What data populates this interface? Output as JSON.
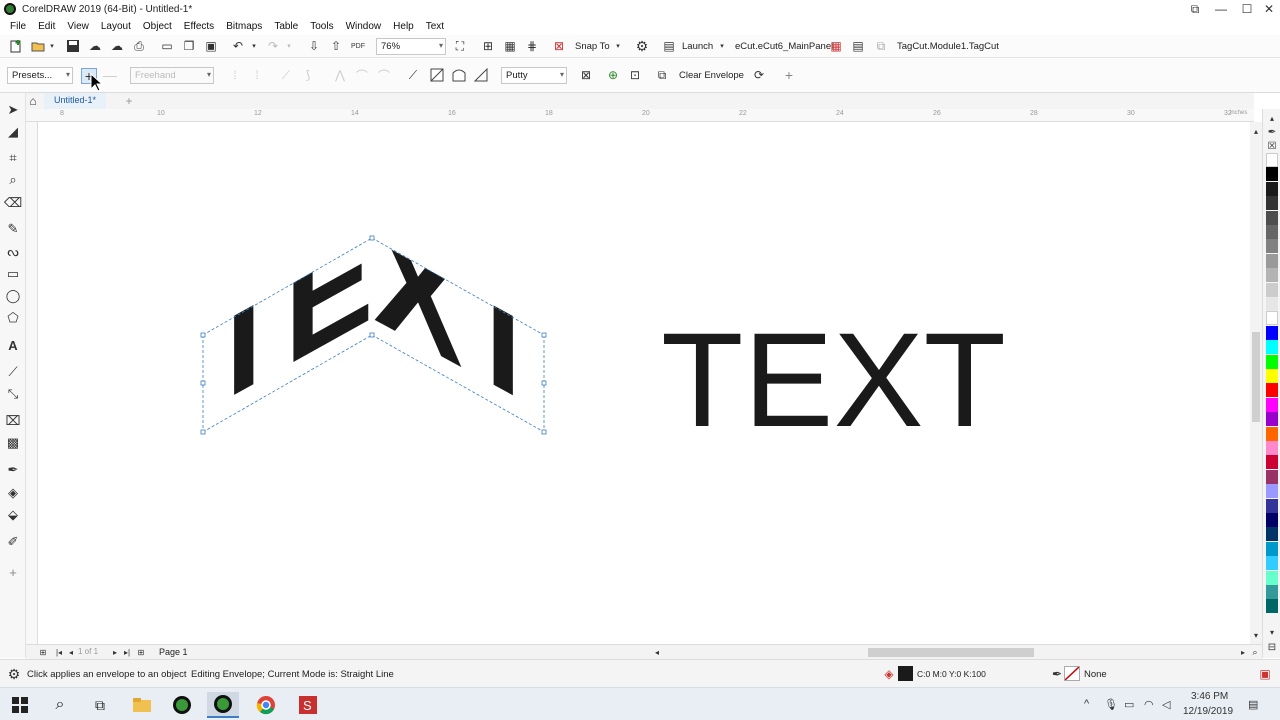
{
  "window": {
    "title": "CorelDRAW 2019 (64-Bit) - Untitled-1*"
  },
  "menu": [
    "File",
    "Edit",
    "View",
    "Layout",
    "Object",
    "Effects",
    "Bitmaps",
    "Table",
    "Tools",
    "Window",
    "Help",
    "Text"
  ],
  "standard_toolbar": {
    "zoom_value": "76%",
    "snap_to_label": "Snap To",
    "launch_label": "Launch",
    "ecut_label": "eCut.eCut6_MainPanel",
    "tagcut_label": "TagCut.Module1.TagCut"
  },
  "property_bar": {
    "presets_label": "Presets...",
    "freehand_label": "Freehand",
    "mapping_mode": "Putty",
    "clear_envelope_label": "Clear Envelope"
  },
  "document": {
    "tab_label": "Untitled-1*",
    "ruler_unit": "inches",
    "ruler_numbers": [
      "8",
      "10",
      "12",
      "14",
      "16",
      "18",
      "20",
      "22",
      "24",
      "26",
      "28",
      "30",
      "32"
    ],
    "page_label": "Page 1",
    "page_counter": "1 of 1"
  },
  "artwork": {
    "enveloped_text": "TEXT",
    "plain_text": "TEXT"
  },
  "palette_colors": [
    "#ffffff",
    "#000000",
    "#1a1a1a",
    "#333333",
    "#4d4d4d",
    "#666666",
    "#808080",
    "#999999",
    "#b3b3b3",
    "#cccccc",
    "#e6e6e6",
    "#ffffff",
    "#0000ff",
    "#00ffff",
    "#00ff00",
    "#ffff00",
    "#ff0000",
    "#ff00ff",
    "#9900cc",
    "#ff6600",
    "#ff88cc",
    "#cc0033",
    "#993366",
    "#9999ff",
    "#333399",
    "#000066",
    "#003366",
    "#0099cc",
    "#33ccff",
    "#66ffcc",
    "#339999",
    "#006666"
  ],
  "status": {
    "hint": "Click applies an envelope to an object",
    "mode": "Editing Envelope;  Current Mode is: Straight Line",
    "fill_color": "C:0 M:0 Y:0 K:100",
    "outline": "None"
  },
  "taskbar": {
    "time": "3:46 PM",
    "date": "12/19/2019"
  }
}
